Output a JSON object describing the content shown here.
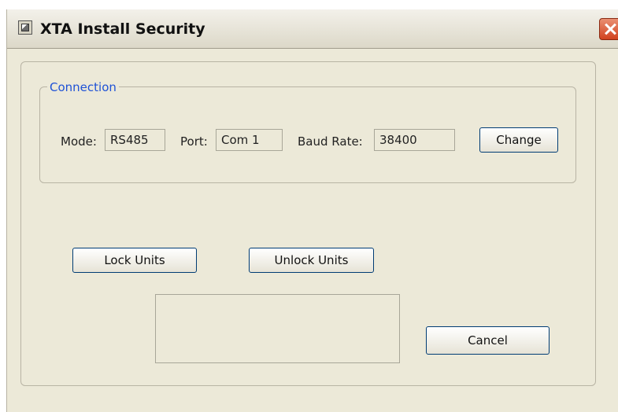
{
  "window": {
    "title": "XTA Install Security"
  },
  "connection": {
    "group_label": "Connection",
    "mode_label": "Mode:",
    "mode_value": "RS485",
    "port_label": "Port:",
    "port_value": "Com 1",
    "baud_label": "Baud Rate:",
    "baud_value": "38400",
    "change_label": "Change"
  },
  "actions": {
    "lock_label": "Lock Units",
    "unlock_label": "Unlock Units",
    "cancel_label": "Cancel"
  },
  "icons": {
    "app": "app-window-icon",
    "close": "close-icon"
  },
  "colors": {
    "dialog_bg": "#ece9d8",
    "group_label": "#1f52d6",
    "close_button": "#d1421f",
    "button_border": "#003c74"
  }
}
